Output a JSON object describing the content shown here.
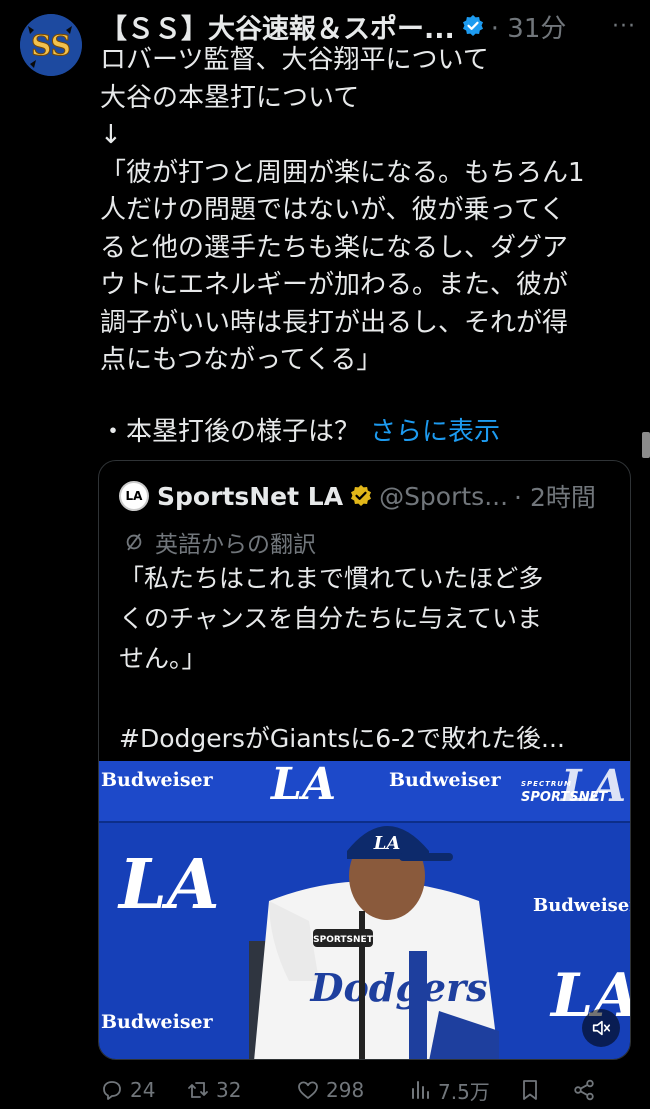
{
  "tweet": {
    "author": "【ＳＳ】大谷速報＆スポー...",
    "time": "· 31分",
    "more": "···",
    "lines": [
      "ロバーツ監督、大谷翔平について",
      "大谷の本塁打について",
      "↓",
      "「彼が打つと周囲が楽になる。もちろん1",
      "人だけの問題ではないが、彼が乗ってく",
      "ると他の選手たちも楽になるし、ダグア",
      "ウトにエネルギーが加わる。また、彼が",
      "調子がいい時は長打が出るし、それが得",
      "点にもつながってくる」"
    ],
    "extra_line": "・本塁打後の様子は？",
    "show_more": "さらに表示"
  },
  "quote": {
    "name": "SportsNet LA",
    "handle": "@Sports...",
    "time": "· 2時間",
    "avatar_text": "LA",
    "translation_label": "英語からの翻訳",
    "lines": [
      "「私たちはこれまで慣れていたほど多",
      "くのチャンスを自分たちに与えていま",
      "せん。」",
      "",
      "#DodgersがGiantsに6-2で敗れた後..."
    ],
    "video": {
      "sponsor": "Budweiser",
      "team_mark": "LA",
      "network_top": "SPECTRUM",
      "network": "SPORTSNET",
      "jersey": "Dodgers"
    }
  },
  "actions": {
    "replies": "24",
    "retweets": "32",
    "likes": "298",
    "views": "7.5万"
  },
  "colors": {
    "background": "#000000",
    "link": "#1d9bf0",
    "muted": "#71767b",
    "verified": "#1d9bf0",
    "gold_check": "#e2b719"
  }
}
